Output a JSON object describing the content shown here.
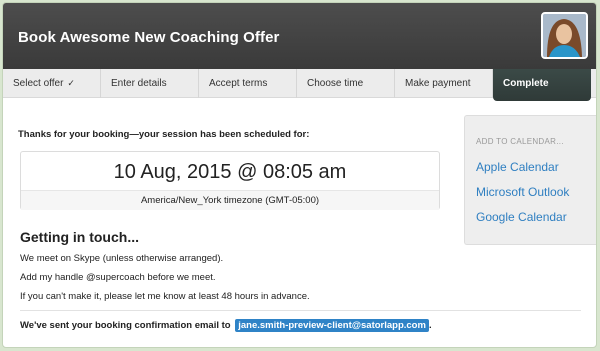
{
  "header": {
    "title": "Book Awesome New Coaching Offer"
  },
  "steps": [
    {
      "label": "Select offer",
      "check": "✓"
    },
    {
      "label": "Enter details"
    },
    {
      "label": "Accept terms"
    },
    {
      "label": "Choose time"
    },
    {
      "label": "Make payment"
    },
    {
      "label": "Complete"
    }
  ],
  "main": {
    "thanks": "Thanks for your booking—your session has been scheduled for:",
    "datetime": "10 Aug, 2015 @ 08:05 am",
    "timezone": "America/New_York timezone (GMT-05:00)",
    "getting_in_touch": "Getting in touch...",
    "para1": "We meet on Skype (unless otherwise arranged).",
    "para2": "Add my handle @supercoach before we meet.",
    "para3": "If you can't make it, please let me know at least 48 hours in advance.",
    "confirm_prefix": "We've sent your booking confirmation email to",
    "email": "jane.smith-preview-client@satorlapp.com",
    "confirm_suffix": "."
  },
  "sidebar": {
    "heading": "ADD TO CALENDAR...",
    "items": [
      "Apple Calendar",
      "Microsoft Outlook",
      "Google Calendar"
    ]
  }
}
